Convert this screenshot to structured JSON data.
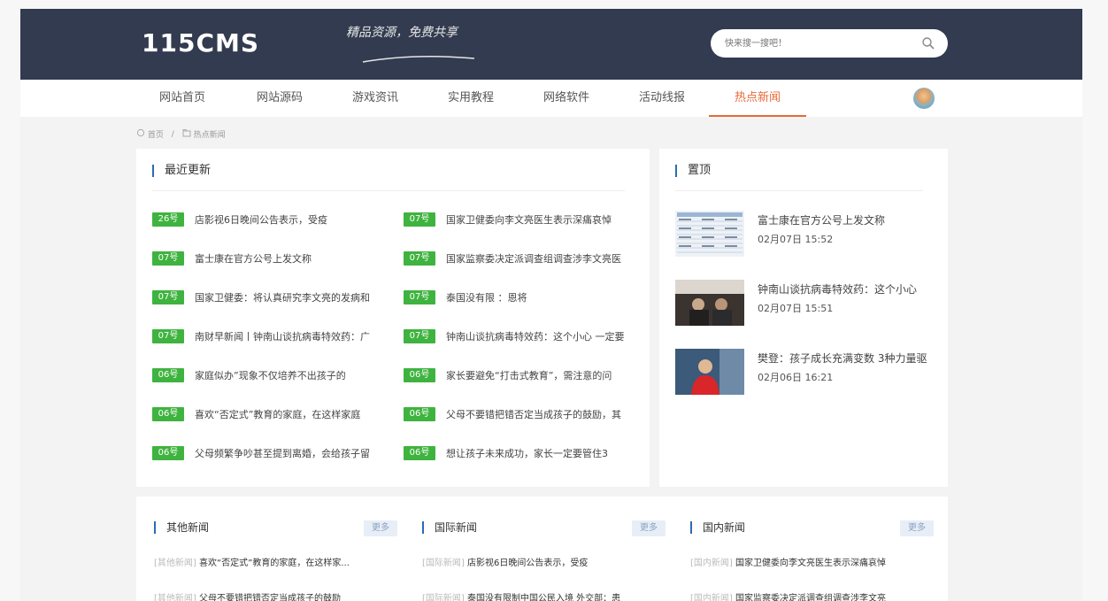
{
  "header": {
    "logo": "115CMS",
    "slogan": "精品资源，免费共享",
    "search_placeholder": "快来搜一搜吧！"
  },
  "nav": {
    "items": [
      "网站首页",
      "网站源码",
      "游戏资讯",
      "实用教程",
      "网络软件",
      "活动线报",
      "热点新闻"
    ],
    "active_index": 6
  },
  "breadcrumb": {
    "home": "首页",
    "separator": "/",
    "current": "热点新闻"
  },
  "latest": {
    "title": "最近更新",
    "left": [
      {
        "tag": "26号",
        "title": "店影视6日晚间公告表示，受疫"
      },
      {
        "tag": "07号",
        "title": "富士康在官方公号上发文称"
      },
      {
        "tag": "07号",
        "title": "国家卫健委：将认真研究李文亮的发病和"
      },
      {
        "tag": "07号",
        "title": "南财早新闻丨钟南山谈抗病毒特效药：广"
      },
      {
        "tag": "06号",
        "title": "家庭似办”现象不仅培养不出孩子的"
      },
      {
        "tag": "06号",
        "title": "喜欢“否定式”教育的家庭，在这样家庭"
      },
      {
        "tag": "06号",
        "title": "父母频繁争吵甚至提到离婚，会给孩子留"
      }
    ],
    "right": [
      {
        "tag": "07号",
        "title": "国家卫健委向李文亮医生表示深痛哀悼"
      },
      {
        "tag": "07号",
        "title": "国家监察委决定派调查组调查涉李文亮医"
      },
      {
        "tag": "07号",
        "title": "泰国没有限                    ：恩将"
      },
      {
        "tag": "07号",
        "title": "钟南山谈抗病毒特效药：这个小心 一定要"
      },
      {
        "tag": "06号",
        "title": "家长要避免“打击式教育”，需注意的问"
      },
      {
        "tag": "06号",
        "title": "父母不要错把错否定当成孩子的鼓励，其"
      },
      {
        "tag": "06号",
        "title": "想让孩子未来成功，家长一定要管住3"
      }
    ]
  },
  "top": {
    "title": "置顶",
    "items": [
      {
        "title": "富士康在官方公号上发文称",
        "time": "02月07日 15:52"
      },
      {
        "title": "钟南山谈抗病毒特效药：这个小心",
        "time": "02月07日 15:51"
      },
      {
        "title": "樊登：孩子成长充满变数 3种力量驱",
        "time": "02月06日 16:21"
      }
    ]
  },
  "categories": [
    {
      "title": "其他新闻",
      "more": "更多",
      "rows": [
        {
          "label": "[其他新闻]",
          "title": "喜欢“否定式”教育的家庭，在这样家..."
        },
        {
          "label": "[其他新闻]",
          "title": "父母不要错把错否定当成孩子的鼓励"
        }
      ]
    },
    {
      "title": "国际新闻",
      "more": "更多",
      "rows": [
        {
          "label": "[国际新闻]",
          "title": "店影视6日晚间公告表示，受疫"
        },
        {
          "label": "[国际新闻]",
          "title": "泰国没有限制中国公民入境 外交部：患"
        }
      ]
    },
    {
      "title": "国内新闻",
      "more": "更多",
      "rows": [
        {
          "label": "[国内新闻]",
          "title": "国家卫健委向李文亮医生表示深痛哀悼"
        },
        {
          "label": "[国内新闻]",
          "title": "国家监察委决定派调查组调查涉李文亮"
        }
      ]
    }
  ],
  "colors": {
    "header_bg": "#323b4f",
    "accent": "#e8693a",
    "tag_green": "#3fb33f",
    "title_bar_blue": "#2c6cb0"
  }
}
